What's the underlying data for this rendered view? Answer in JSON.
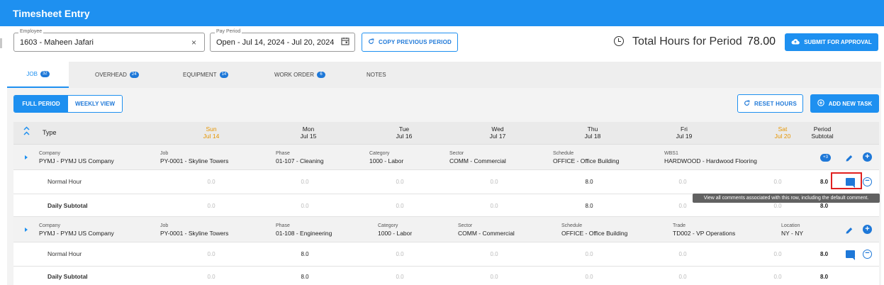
{
  "app": {
    "title": "Timesheet Entry"
  },
  "header": {
    "employee": {
      "label": "Employee",
      "value": "1603 - Maheen Jafari"
    },
    "pay_period": {
      "label": "Pay Period",
      "value": "Open - Jul 14, 2024 - Jul 20, 2024"
    },
    "copy_previous_label": "COPY PREVIOUS PERIOD",
    "total_hours_label": "Total Hours for Period",
    "total_hours_value": "78.00",
    "submit_label": "SUBMIT FOR APPROVAL"
  },
  "tabs": [
    {
      "label": "JOB",
      "count": "32",
      "active": true
    },
    {
      "label": "OVERHEAD",
      "count": "24"
    },
    {
      "label": "EQUIPMENT",
      "count": "14"
    },
    {
      "label": "WORK ORDER",
      "count": "6"
    },
    {
      "label": "NOTES"
    }
  ],
  "toolbar": {
    "full_period": "FULL PERIOD",
    "weekly_view": "WEEKLY VIEW",
    "reset_hours": "RESET HOURS",
    "add_new_task": "ADD NEW TASK"
  },
  "grid": {
    "type_header": "Type",
    "days": [
      {
        "day": "Sun",
        "date": "Jul 14"
      },
      {
        "day": "Mon",
        "date": "Jul 15"
      },
      {
        "day": "Tue",
        "date": "Jul 16"
      },
      {
        "day": "Wed",
        "date": "Jul 17"
      },
      {
        "day": "Thu",
        "date": "Jul 18"
      },
      {
        "day": "Fri",
        "date": "Jul 19"
      },
      {
        "day": "Sat",
        "date": "Jul 20"
      }
    ],
    "period_subtotal_header": [
      "Period",
      "Subtotal"
    ],
    "groups": [
      {
        "fields": [
          {
            "k": "Company",
            "v": "PYMJ - PYMJ US Company"
          },
          {
            "k": "Job",
            "v": "PY-0001 - Skyline Towers"
          },
          {
            "k": "Phase",
            "v": "01-107 - Cleaning"
          },
          {
            "k": "Category",
            "v": "1000 - Labor"
          },
          {
            "k": "Sector",
            "v": "COMM - Commercial"
          },
          {
            "k": "Schedule",
            "v": "OFFICE - Office Building"
          },
          {
            "k": "WBS1",
            "v": "HARDWOOD - Hardwood Flooring"
          }
        ],
        "more_badge": "+3",
        "hours_label": "Normal Hour",
        "hours": [
          "0.0",
          "0.0",
          "0.0",
          "0.0",
          "8.0",
          "0.0",
          "0.0"
        ],
        "hours_total": "8.0",
        "subtotal_label": "Daily Subtotal",
        "subtotal": [
          "0.0",
          "0.0",
          "0.0",
          "0.0",
          "8.0",
          "0.0",
          "0.0"
        ],
        "subtotal_total": "8.0"
      },
      {
        "fields": [
          {
            "k": "Company",
            "v": "PYMJ - PYMJ US Company"
          },
          {
            "k": "Job",
            "v": "PY-0001 - Skyline Towers"
          },
          {
            "k": "Phase",
            "v": "01-108 - Engineering"
          },
          {
            "k": "Category",
            "v": "1000 - Labor"
          },
          {
            "k": "Sector",
            "v": "COMM - Commercial"
          },
          {
            "k": "Schedule",
            "v": "OFFICE - Office Building"
          },
          {
            "k": "Trade",
            "v": "TD002 - VP Operations"
          },
          {
            "k": "Location",
            "v": "NY - NY"
          }
        ],
        "hours_label": "Normal Hour",
        "hours": [
          "0.0",
          "8.0",
          "0.0",
          "0.0",
          "0.0",
          "0.0",
          "0.0"
        ],
        "hours_total": "8.0",
        "subtotal_label": "Daily Subtotal",
        "subtotal": [
          "0.0",
          "8.0",
          "0.0",
          "0.0",
          "0.0",
          "0.0",
          "0.0"
        ],
        "subtotal_total": "8.0"
      }
    ]
  },
  "tooltip": "View all comments associated with this row, including the default comment.",
  "colors": {
    "primary": "#1e90f0",
    "weekend": "#e69500",
    "highlight": "#e02020"
  }
}
